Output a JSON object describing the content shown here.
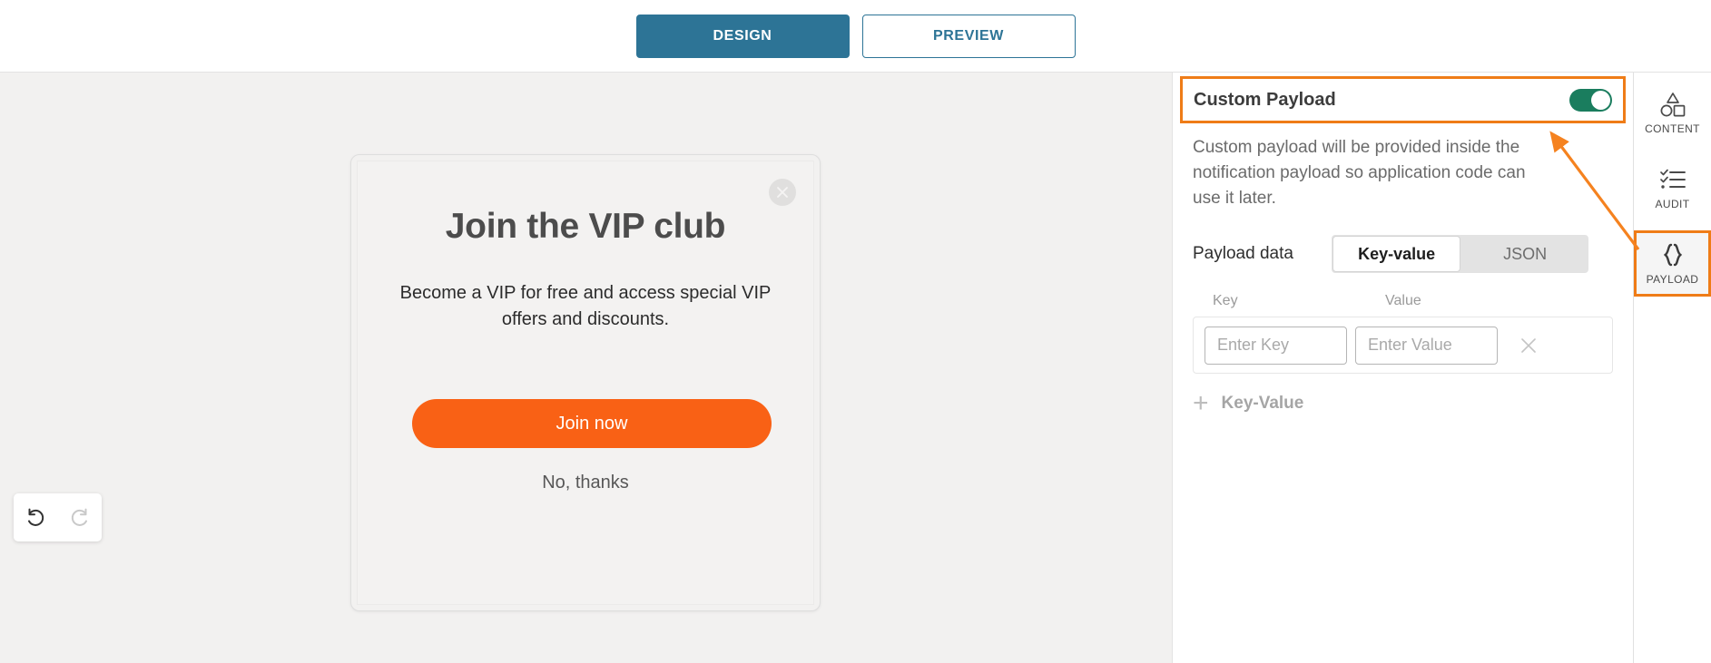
{
  "header": {
    "tabs": [
      {
        "label": "DESIGN",
        "state": "active"
      },
      {
        "label": "PREVIEW",
        "state": "inactive"
      }
    ]
  },
  "canvas": {
    "modal": {
      "title": "Join the VIP club",
      "subtitle": "Become a VIP for free and access special VIP offers and discounts.",
      "cta_label": "Join now",
      "decline_label": "No, thanks",
      "close_icon": "close-icon",
      "cta_color": "#f96115",
      "background": "#f3f2f1"
    },
    "history": {
      "undo_icon": "undo-icon",
      "redo_icon": "redo-icon",
      "undo_state": "enabled",
      "redo_state": "disabled"
    },
    "background": "#f2f1f0"
  },
  "panel": {
    "title": "Custom Payload",
    "toggle_state": "on",
    "toggle_color": "#1a7d5e",
    "description": "Custom payload will be provided inside the notification payload so application code can use it later.",
    "payload_data_label": "Payload data",
    "format_tabs": [
      {
        "label": "Key-value",
        "state": "active"
      },
      {
        "label": "JSON",
        "state": "inactive"
      }
    ],
    "column_headers": {
      "key": "Key",
      "value": "Value"
    },
    "rows": [
      {
        "key_value": "",
        "key_placeholder": "Enter Key",
        "value_value": "",
        "value_placeholder": "Enter Value",
        "remove_icon": "close-icon"
      }
    ],
    "add_row_label": "Key-Value",
    "add_row_icon": "plus-icon",
    "highlight_color": "#ef7c17"
  },
  "rail": {
    "items": [
      {
        "label": "CONTENT",
        "icon": "shapes-icon",
        "state": "normal"
      },
      {
        "label": "AUDIT",
        "icon": "checklist-icon",
        "state": "normal"
      },
      {
        "label": "PAYLOAD",
        "icon": "braces-icon",
        "state": "selected"
      }
    ]
  },
  "annotation": {
    "arrow_color": "#f5821f",
    "arrow_from": "payload-rail-item",
    "arrow_to": "custom-payload-toggle"
  }
}
